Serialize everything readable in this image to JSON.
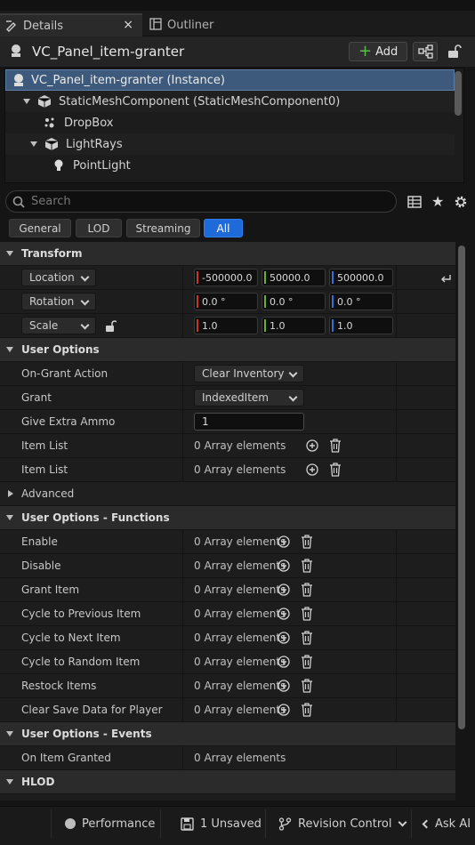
{
  "tabs": {
    "details": "Details",
    "outliner": "Outliner",
    "close": "×"
  },
  "header": {
    "actor_name": "VC_Panel_item-granter",
    "add_label": "Add",
    "add_plus": "+"
  },
  "tree": {
    "rows": [
      {
        "label": "VC_Panel_item-granter (Instance)"
      },
      {
        "label": "StaticMeshComponent (StaticMeshComponent0)"
      },
      {
        "label": "DropBox"
      },
      {
        "label": "LightRays"
      },
      {
        "label": "PointLight"
      }
    ]
  },
  "search": {
    "placeholder": "Search"
  },
  "filters": [
    "General",
    "LOD",
    "Streaming",
    "All"
  ],
  "active_filter": "All",
  "transform": {
    "title": "Transform",
    "location": {
      "label": "Location",
      "x": "-500000.0",
      "y": "50000.0",
      "z": "500000.0"
    },
    "rotation": {
      "label": "Rotation",
      "x": "0.0 °",
      "y": "0.0 °",
      "z": "0.0 °"
    },
    "scale": {
      "label": "Scale",
      "x": "1.0",
      "y": "1.0",
      "z": "1.0"
    }
  },
  "user_options": {
    "title": "User Options",
    "on_grant_action": {
      "label": "On-Grant Action",
      "value": "Clear Inventory"
    },
    "grant": {
      "label": "Grant",
      "value": "IndexedItem"
    },
    "give_extra_ammo": {
      "label": "Give Extra Ammo",
      "value": "1"
    },
    "item_list_1": {
      "label": "Item List",
      "value": "0 Array elements"
    },
    "item_list_2": {
      "label": "Item List",
      "value": "0 Array elements"
    }
  },
  "advanced": {
    "title": "Advanced"
  },
  "functions": {
    "title": "User Options - Functions",
    "rows": [
      {
        "label": "Enable",
        "value": "0 Array elements"
      },
      {
        "label": "Disable",
        "value": "0 Array elements"
      },
      {
        "label": "Grant Item",
        "value": "0 Array elements"
      },
      {
        "label": "Cycle to Previous Item",
        "value": "0 Array elements"
      },
      {
        "label": "Cycle to Next Item",
        "value": "0 Array elements"
      },
      {
        "label": "Cycle to Random Item",
        "value": "0 Array elements"
      },
      {
        "label": "Restock Items",
        "value": "0 Array elements"
      },
      {
        "label": "Clear Save Data for Player",
        "value": "0 Array elements"
      }
    ]
  },
  "events": {
    "title": "User Options - Events",
    "on_item_granted": {
      "label": "On Item Granted",
      "value": "0 Array elements"
    }
  },
  "hlod": {
    "title": "HLOD"
  },
  "statusbar": {
    "performance": "Performance",
    "unsaved": "1 Unsaved",
    "revision_control": "Revision Control",
    "ask_ai": "Ask AI"
  },
  "colors": {
    "accent_blue": "#1e6ad9",
    "axis_x": "#c8352d",
    "axis_y": "#6fae2b",
    "axis_z": "#2f6fd6",
    "add_green": "#5bbd4a"
  },
  "icons": [
    "details-icon",
    "outliner-icon",
    "actor-icon",
    "blueprint-icon",
    "lock-icon",
    "search-icon",
    "table-view-icon",
    "star-icon",
    "gear-icon",
    "reset-arrow-icon",
    "plus-circle-icon",
    "trash-icon",
    "performance-icon",
    "save-icon",
    "revision-control-icon",
    "chevron-left-icon"
  ]
}
